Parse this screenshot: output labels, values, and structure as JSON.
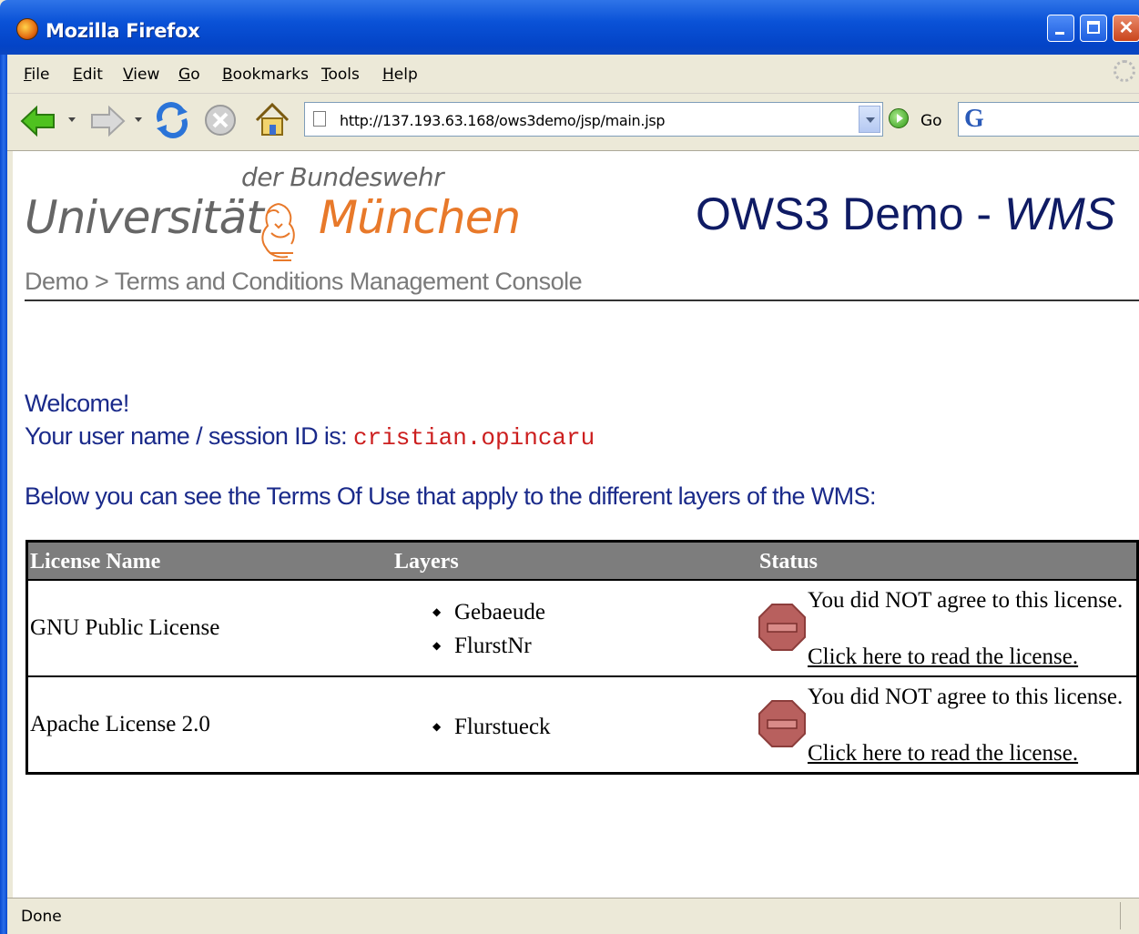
{
  "window": {
    "title": "Mozilla Firefox"
  },
  "menu": [
    "File",
    "Edit",
    "View",
    "Go",
    "Bookmarks",
    "Tools",
    "Help"
  ],
  "nav": {
    "url": "http://137.193.63.168/ows3demo/jsp/main.jsp",
    "go_label": "Go"
  },
  "header": {
    "logo_top": "der Bundeswehr",
    "logo_left": "Universität",
    "logo_right": "München",
    "title_plain": "OWS3 Demo - ",
    "title_italic": "WMS",
    "breadcrumb": "Demo > Terms and Conditions Management Console"
  },
  "main": {
    "welcome": "Welcome!",
    "session_label": "Your user name / session ID is: ",
    "session_id": "cristian.opincaru",
    "intro": "Below you can see the Terms Of Use that apply to the different layers of the WMS:"
  },
  "table": {
    "headers": [
      "License Name",
      "Layers",
      "Status"
    ],
    "rows": [
      {
        "name": "GNU Public License",
        "layers": [
          "Gebaeude",
          "FlurstNr"
        ],
        "status": "You did NOT agree to this license.",
        "link": "Click here to read the license."
      },
      {
        "name": "Apache License 2.0",
        "layers": [
          "Flurstueck"
        ],
        "status": "You did NOT agree to this license.",
        "link": "Click here to read the license."
      }
    ]
  },
  "statusbar": {
    "text": "Done"
  },
  "colors": {
    "title_blue": "#0f1b64",
    "logo_orange": "#e8792a",
    "session_red": "#cc1f1f",
    "table_header": "#7d7d7d"
  }
}
